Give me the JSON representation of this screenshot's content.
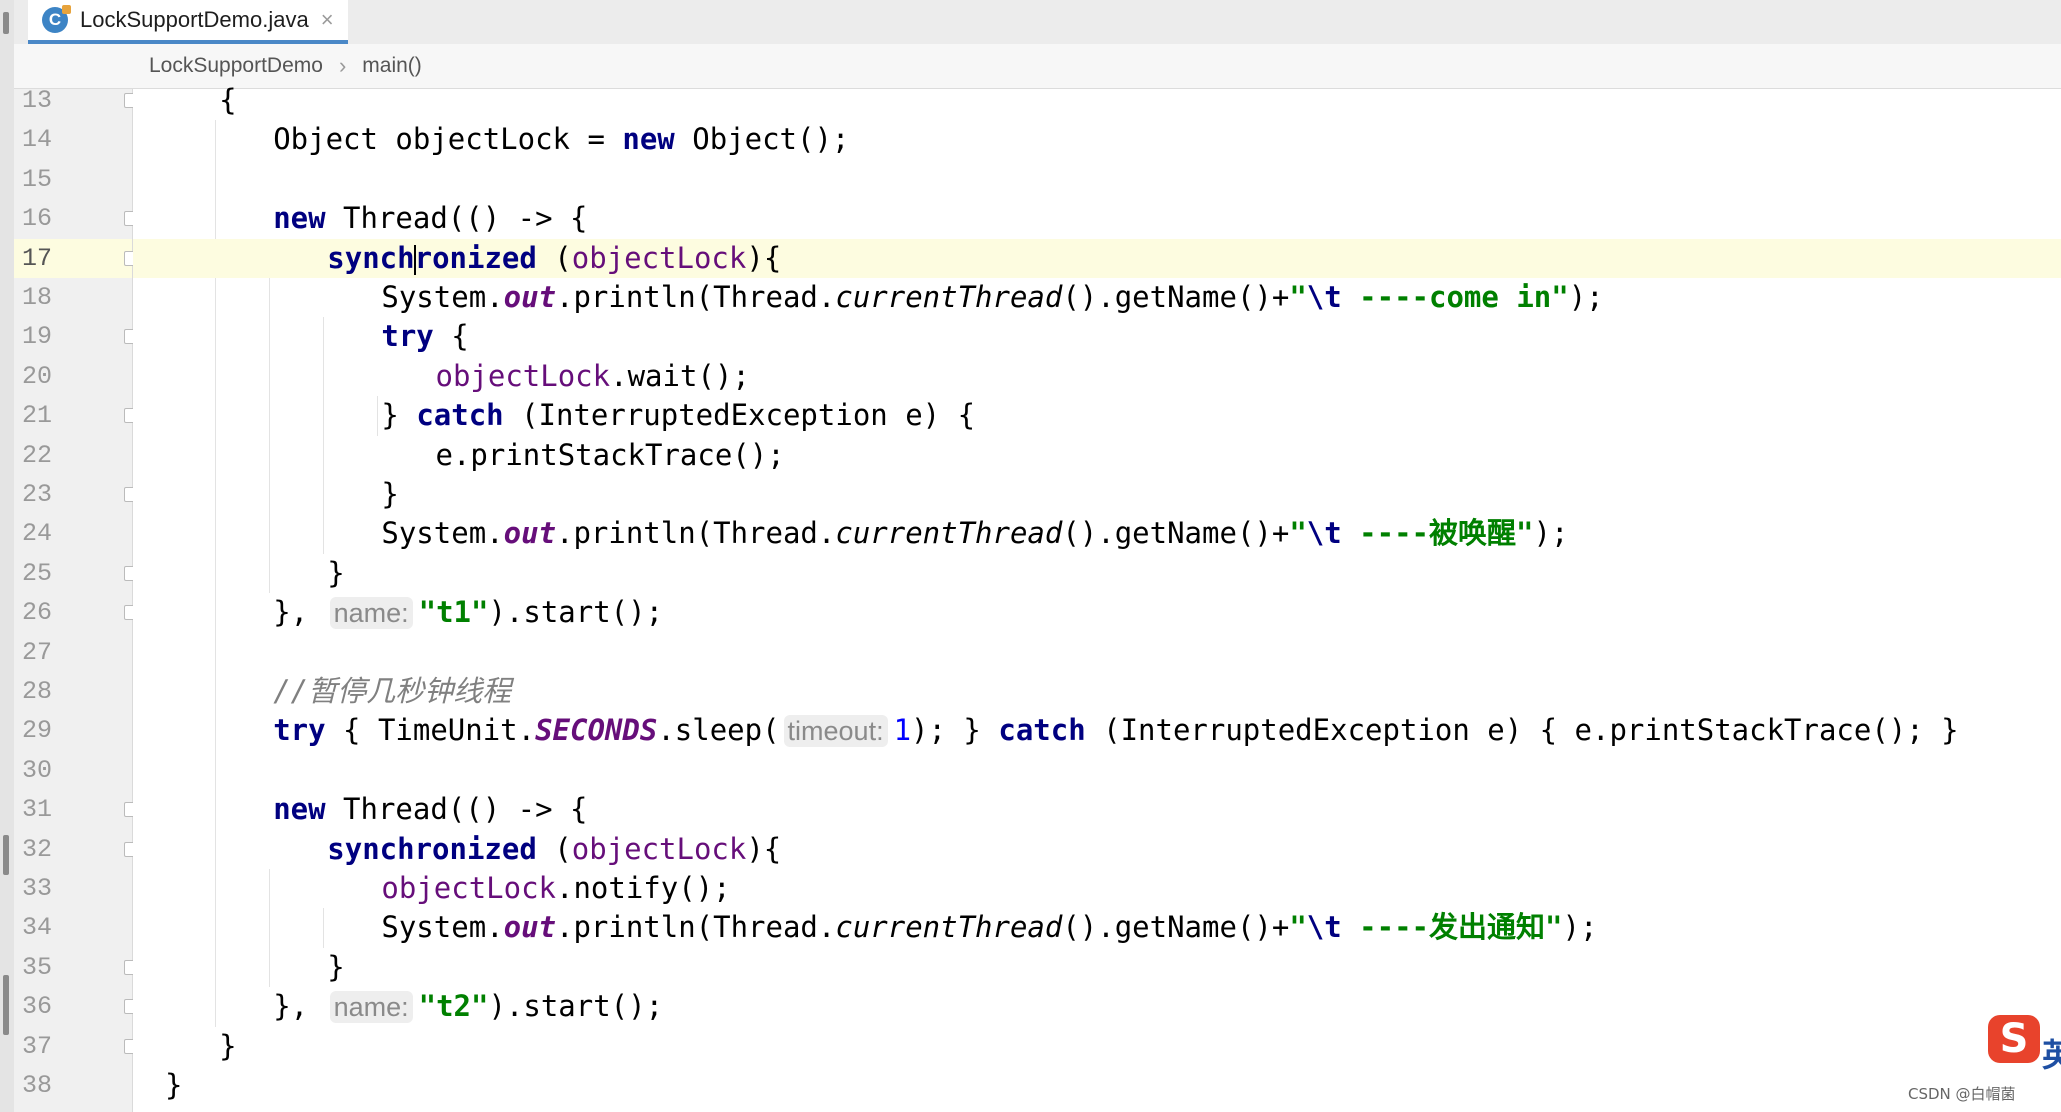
{
  "tab": {
    "file_icon": "java-class-icon",
    "title": "LockSupportDemo.java",
    "close": "×"
  },
  "breadcrumb": [
    "LockSupportDemo",
    "main()"
  ],
  "current_line": 17,
  "lines": [
    {
      "n": "13",
      "segs": [
        [
          "",
          "{"
        ]
      ]
    },
    {
      "n": "14",
      "segs": [
        [
          "",
          "Object objectLock = "
        ],
        [
          "kw",
          "new"
        ],
        [
          "",
          " Object();"
        ]
      ]
    },
    {
      "n": "15",
      "segs": []
    },
    {
      "n": "16",
      "segs": [
        [
          "kw",
          "new"
        ],
        [
          "",
          " Thread(() -> {"
        ]
      ]
    },
    {
      "n": "17",
      "segs": [
        [
          "kw",
          "synch"
        ],
        [
          "cursor",
          ""
        ],
        [
          "kw",
          "ronized"
        ],
        [
          "",
          " ("
        ],
        [
          "fld",
          "objectLock"
        ],
        [
          "",
          "){"
        ]
      ]
    },
    {
      "n": "18",
      "segs": [
        [
          "",
          "System."
        ],
        [
          "st",
          "out"
        ],
        [
          "",
          ".println(Thread."
        ],
        [
          "it",
          "currentThread"
        ],
        [
          "",
          "().getName()+"
        ],
        [
          "str",
          "\""
        ],
        [
          "esc",
          "\\t"
        ],
        [
          "str",
          " ----come in\""
        ],
        [
          "",
          ");"
        ]
      ]
    },
    {
      "n": "19",
      "segs": [
        [
          "kw",
          "try"
        ],
        [
          "",
          " {"
        ]
      ]
    },
    {
      "n": "20",
      "segs": [
        [
          "fld",
          "objectLock"
        ],
        [
          "",
          ".wait();"
        ]
      ]
    },
    {
      "n": "21",
      "segs": [
        [
          "",
          "} "
        ],
        [
          "kw",
          "catch"
        ],
        [
          "",
          " (InterruptedException e) {"
        ]
      ]
    },
    {
      "n": "22",
      "segs": [
        [
          "",
          "e.printStackTrace();"
        ]
      ]
    },
    {
      "n": "23",
      "segs": [
        [
          "",
          "}"
        ]
      ]
    },
    {
      "n": "24",
      "segs": [
        [
          "",
          "System."
        ],
        [
          "st",
          "out"
        ],
        [
          "",
          ".println(Thread."
        ],
        [
          "it",
          "currentThread"
        ],
        [
          "",
          "().getName()+"
        ],
        [
          "str",
          "\""
        ],
        [
          "esc",
          "\\t"
        ],
        [
          "str",
          " ----被唤醒\""
        ],
        [
          "",
          ");"
        ]
      ]
    },
    {
      "n": "25",
      "segs": [
        [
          "",
          "}"
        ]
      ]
    },
    {
      "n": "26",
      "segs": [
        [
          "",
          "}, "
        ],
        [
          "hint",
          "name:"
        ],
        [
          "str",
          "\"t1\""
        ],
        [
          "",
          ").start();"
        ]
      ]
    },
    {
      "n": "27",
      "segs": []
    },
    {
      "n": "28",
      "segs": [
        [
          "cmt",
          "//暂停几秒钟线程"
        ]
      ]
    },
    {
      "n": "29",
      "segs": [
        [
          "kw",
          "try"
        ],
        [
          "",
          " { TimeUnit."
        ],
        [
          "st",
          "SECONDS"
        ],
        [
          "",
          ".sleep("
        ],
        [
          "hint",
          "timeout:"
        ],
        [
          "num",
          "1"
        ],
        [
          "",
          "); } "
        ],
        [
          "kw",
          "catch"
        ],
        [
          "",
          " (InterruptedException e) { e.printStackTrace(); }"
        ]
      ]
    },
    {
      "n": "30",
      "segs": []
    },
    {
      "n": "31",
      "segs": [
        [
          "kw",
          "new"
        ],
        [
          "",
          " Thread(() -> {"
        ]
      ]
    },
    {
      "n": "32",
      "segs": [
        [
          "kw",
          "synchronized"
        ],
        [
          "",
          " ("
        ],
        [
          "fld",
          "objectLock"
        ],
        [
          "",
          "){"
        ]
      ]
    },
    {
      "n": "33",
      "segs": [
        [
          "fld",
          "objectLock"
        ],
        [
          "",
          ".notify();"
        ]
      ]
    },
    {
      "n": "34",
      "segs": [
        [
          "",
          "System."
        ],
        [
          "st",
          "out"
        ],
        [
          "",
          ".println(Thread."
        ],
        [
          "it",
          "currentThread"
        ],
        [
          "",
          "().getName()+"
        ],
        [
          "str",
          "\""
        ],
        [
          "esc",
          "\\t"
        ],
        [
          "str",
          " ----发出通知\""
        ],
        [
          "",
          ");"
        ]
      ]
    },
    {
      "n": "35",
      "segs": [
        [
          "",
          "}"
        ]
      ]
    },
    {
      "n": "36",
      "segs": [
        [
          "",
          "}, "
        ],
        [
          "hint",
          "name:"
        ],
        [
          "str",
          "\"t2\""
        ],
        [
          "",
          ").start();"
        ]
      ]
    },
    {
      "n": "37",
      "segs": [
        [
          "",
          "}"
        ]
      ]
    },
    {
      "n": "38",
      "segs": [
        [
          "",
          "}"
        ]
      ]
    }
  ],
  "ime": {
    "icon": "sogou-ime-icon",
    "glyph": "S",
    "label": "英"
  },
  "watermark": "CSDN @白帽菌"
}
